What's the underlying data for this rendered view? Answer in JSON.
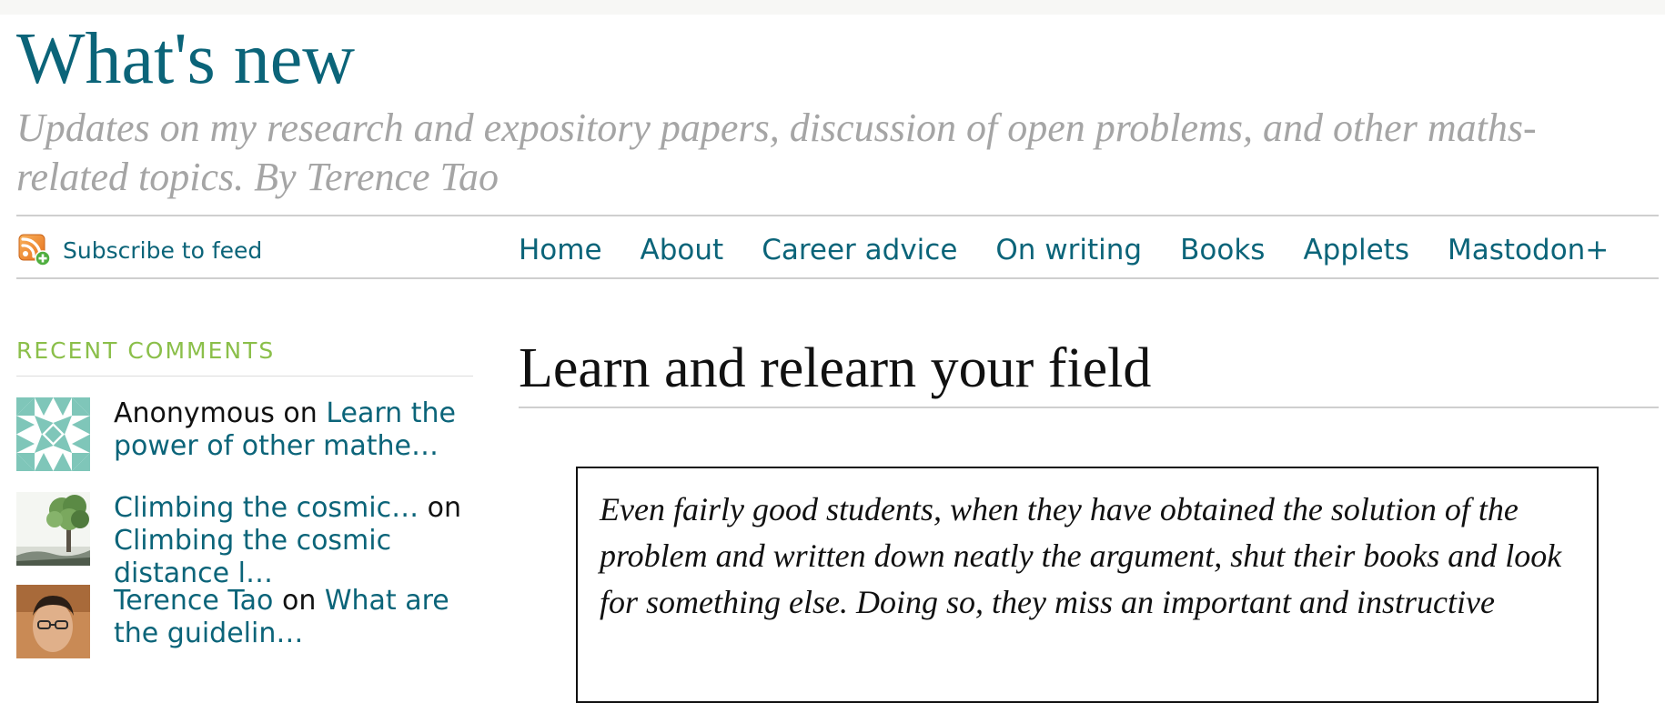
{
  "site": {
    "title": "What's new",
    "description": "Updates on my research and expository papers, discussion of open problems, and other maths-related topics. By Terence Tao"
  },
  "feed": {
    "icon": "rss-feed-icon",
    "label": "Subscribe to feed"
  },
  "nav": {
    "items": [
      {
        "label": "Home"
      },
      {
        "label": "About"
      },
      {
        "label": "Career advice"
      },
      {
        "label": "On writing"
      },
      {
        "label": "Books"
      },
      {
        "label": "Applets"
      },
      {
        "label": "Mastodon+"
      }
    ]
  },
  "sidebar": {
    "recent_comments_title": "RECENT COMMENTS",
    "comments": [
      {
        "author": "Anonymous",
        "on": " on ",
        "post": "Learn the power of other mathe…",
        "avatar": "identicon-avatar"
      },
      {
        "author": "Climbing the cosmic…",
        "on": " on ",
        "post": "Climbing the cosmic distance l…",
        "avatar": "tree-photo-avatar"
      },
      {
        "author": "Terence Tao",
        "on": " on ",
        "post": "What are the guidelin…",
        "avatar": "person-photo-avatar"
      }
    ]
  },
  "post": {
    "title": "Learn and relearn your field",
    "quote": "Even fairly good students, when they have obtained the solution of the problem and written down neatly the argument, shut their books and look for something else. Doing so, they miss an important and instructive"
  },
  "colors": {
    "link": "#0b6479",
    "widget_title": "#8bbf4a",
    "description": "#a5a5a5",
    "rss_orange": "#f28c28",
    "rss_badge_green": "#5cb85c"
  }
}
